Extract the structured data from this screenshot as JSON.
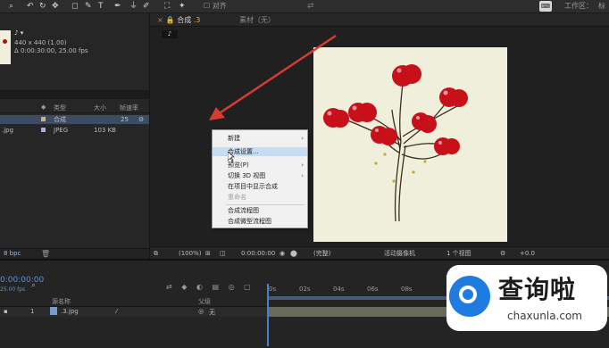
{
  "toolbar": {
    "tools": [
      "⌕",
      "↶",
      "↻",
      "✥",
      "◻",
      "✎",
      "T",
      "✒",
      "⏚",
      "✐",
      "⛶",
      "✦"
    ],
    "snap_label": "对齐",
    "kbd_chip": "⌨",
    "workspace_label": "工作区：",
    "workspace_value": "标"
  },
  "project": {
    "comp_icon_label": "♪ ▾",
    "comp_size": "440 x 440 (1.00)",
    "comp_duration": "Δ 0:00:30:00, 25.00 fps",
    "columns": {
      "type": "类型",
      "size": "大小",
      "rate": "帧速率"
    },
    "items": [
      {
        "name": "",
        "type": "合成",
        "size": "",
        "rate": "25",
        "chip_color": "#c8b488",
        "selected": true
      },
      {
        "name": ".jpg",
        "type": "JPEG",
        "size": "103 KB",
        "rate": "",
        "chip_color": "#b8a8d8",
        "selected": false
      }
    ],
    "bpc": "8 bpc"
  },
  "viewer": {
    "tab_comp_label": "合成",
    "tab_comp_name": ".3",
    "tab_footage_label": "素材（无）",
    "comp_badge": "♪",
    "bar": {
      "zoom": "(100%)",
      "timecode": "0:00:00:00",
      "resolution": "(完整)",
      "camera": "活动摄像机",
      "views": "1 个视图",
      "exposure": "+0.0"
    }
  },
  "context_menu": {
    "items": [
      {
        "label": "新建",
        "submenu": true,
        "state": "normal"
      },
      {
        "label": "合成设置...",
        "submenu": false,
        "state": "highlighted"
      },
      {
        "label": "预览(P)",
        "submenu": true,
        "state": "normal"
      },
      {
        "label": "切换 3D 视图",
        "submenu": true,
        "state": "normal"
      },
      {
        "label": "在项目中显示合成",
        "submenu": false,
        "state": "normal"
      },
      {
        "label": "重命名",
        "submenu": false,
        "state": "disabled"
      },
      {
        "label": "合成流程图",
        "submenu": false,
        "state": "normal"
      },
      {
        "label": "合成微型流程图",
        "submenu": false,
        "state": "normal"
      }
    ]
  },
  "timeline": {
    "current_time": "0:00:00:00",
    "fps": "25.00 fps",
    "search_icon": "⌕",
    "source_name_header": "源名称",
    "parent_header": "父级",
    "layer": {
      "index": "1",
      "name": ".3.jpg",
      "parent": "无"
    },
    "ruler_ticks": [
      "0s",
      "02s",
      "04s",
      "06s",
      "08s"
    ]
  },
  "watermark": {
    "title": "查询啦",
    "url": "chaxunla.com"
  },
  "colors": {
    "accent_blue": "#4d7fc7",
    "annotation_red": "#d93a32",
    "cherry_red": "#c8101a"
  }
}
